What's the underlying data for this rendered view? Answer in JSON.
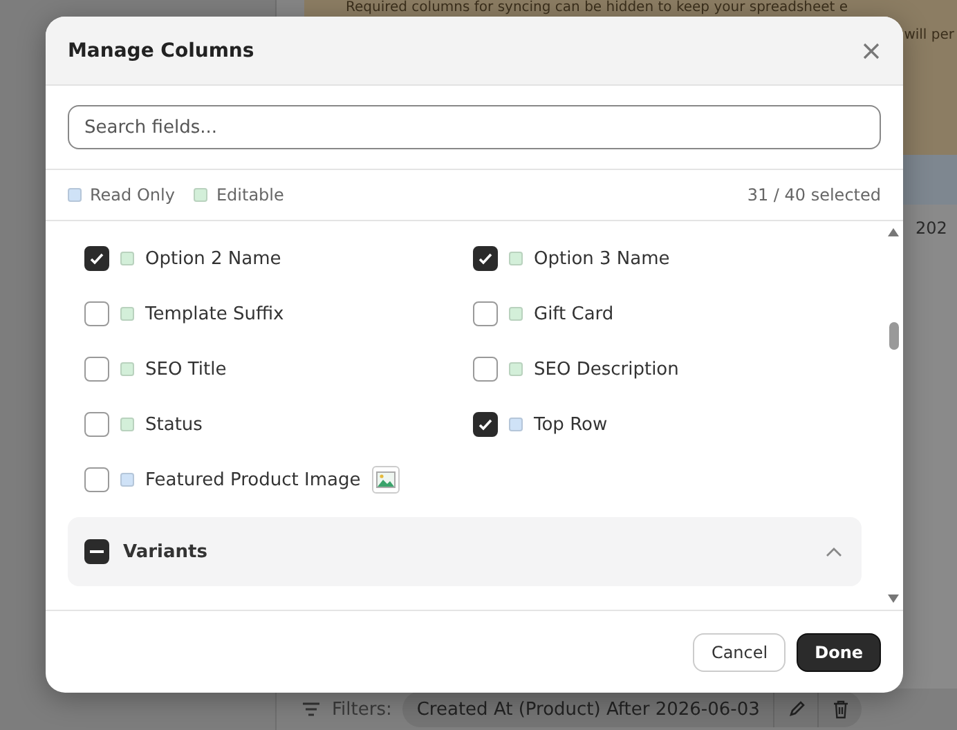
{
  "page": {
    "banner": {
      "line_1": "Required columns for syncing can be hidden to keep your spreadsheet e",
      "line_2": "will per"
    },
    "table_cell": "202",
    "filters": {
      "label": "Filters:",
      "chip": "Created At (Product) After 2026-06-03"
    }
  },
  "dialog": {
    "title": "Manage Columns",
    "search": {
      "placeholder": "Search fields..."
    },
    "legend": [
      {
        "label": "Read Only",
        "color": "#cfe2f7"
      },
      {
        "label": "Editable",
        "color": "#d3efd9"
      }
    ],
    "count": "31 / 40 selected",
    "fields": [
      {
        "label": "Option 2 Name",
        "checked": true,
        "color": "#d3efd9"
      },
      {
        "label": "Option 3 Name",
        "checked": true,
        "color": "#d3efd9"
      },
      {
        "label": "Template Suffix",
        "checked": false,
        "color": "#d3efd9"
      },
      {
        "label": "Gift Card",
        "checked": false,
        "color": "#d3efd9"
      },
      {
        "label": "SEO Title",
        "checked": false,
        "color": "#d3efd9"
      },
      {
        "label": "SEO Description",
        "checked": false,
        "color": "#d3efd9"
      },
      {
        "label": "Status",
        "checked": false,
        "color": "#d3efd9"
      },
      {
        "label": "Top Row",
        "checked": true,
        "color": "#cfe2f7"
      },
      {
        "label": "Featured Product Image",
        "checked": false,
        "color": "#cfe2f7",
        "image": true
      }
    ],
    "section": {
      "label": "Variants",
      "expanded": true,
      "partial": true
    },
    "buttons": [
      {
        "label": "Cancel",
        "kind": "secondary"
      },
      {
        "label": "Done",
        "kind": "primary"
      }
    ]
  }
}
